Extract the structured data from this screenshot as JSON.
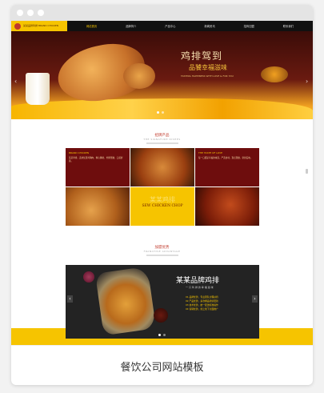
{
  "nav": {
    "logo_text": "某某品牌鸡排 BRAND CHICKEN",
    "links": [
      "网站首页",
      "品牌简介",
      "产品中心",
      "新闻资讯",
      "招商加盟",
      "联系我们"
    ]
  },
  "hero": {
    "title": "鸡排驾到",
    "subtitle": "品饕幸福滋味",
    "en": "TASTING HAPPINESS WITH LOVE & FOR YOU"
  },
  "section1": {
    "title_cn": "招牌产品",
    "title_en": "THE SIGNATURE DISHES",
    "cells": [
      {
        "title": "BRAND CHICKEN",
        "text": "某某鸡排，选用优质鸡胸肉，精心腌制，外酥里嫩，口感鲜香。"
      },
      {
        "title": "THE TASTE OF LOVE",
        "text": "每一口都是幸福的味道，严选食材，现点现做，新鲜美味。"
      }
    ],
    "yellow_big": "某某鸡排",
    "yellow_en": "SEW CHICKEN CHOP"
  },
  "section2": {
    "title_cn": "加盟优势",
    "title_en": "FRANCHISE ADVANTAGE",
    "panel_title": "某某品牌鸡排",
    "panel_sub": "一 只 鸡 排 的 幸 福 滋 味",
    "panel_lines": [
      "01 品牌优势，专业团队全程扶持",
      "02 产品优势，多款爆品持续更新",
      "03 技术优势，统一配送标准操作",
      "04 营销优势，线上线下全面推广"
    ]
  },
  "caption": "餐饮公司网站模板"
}
